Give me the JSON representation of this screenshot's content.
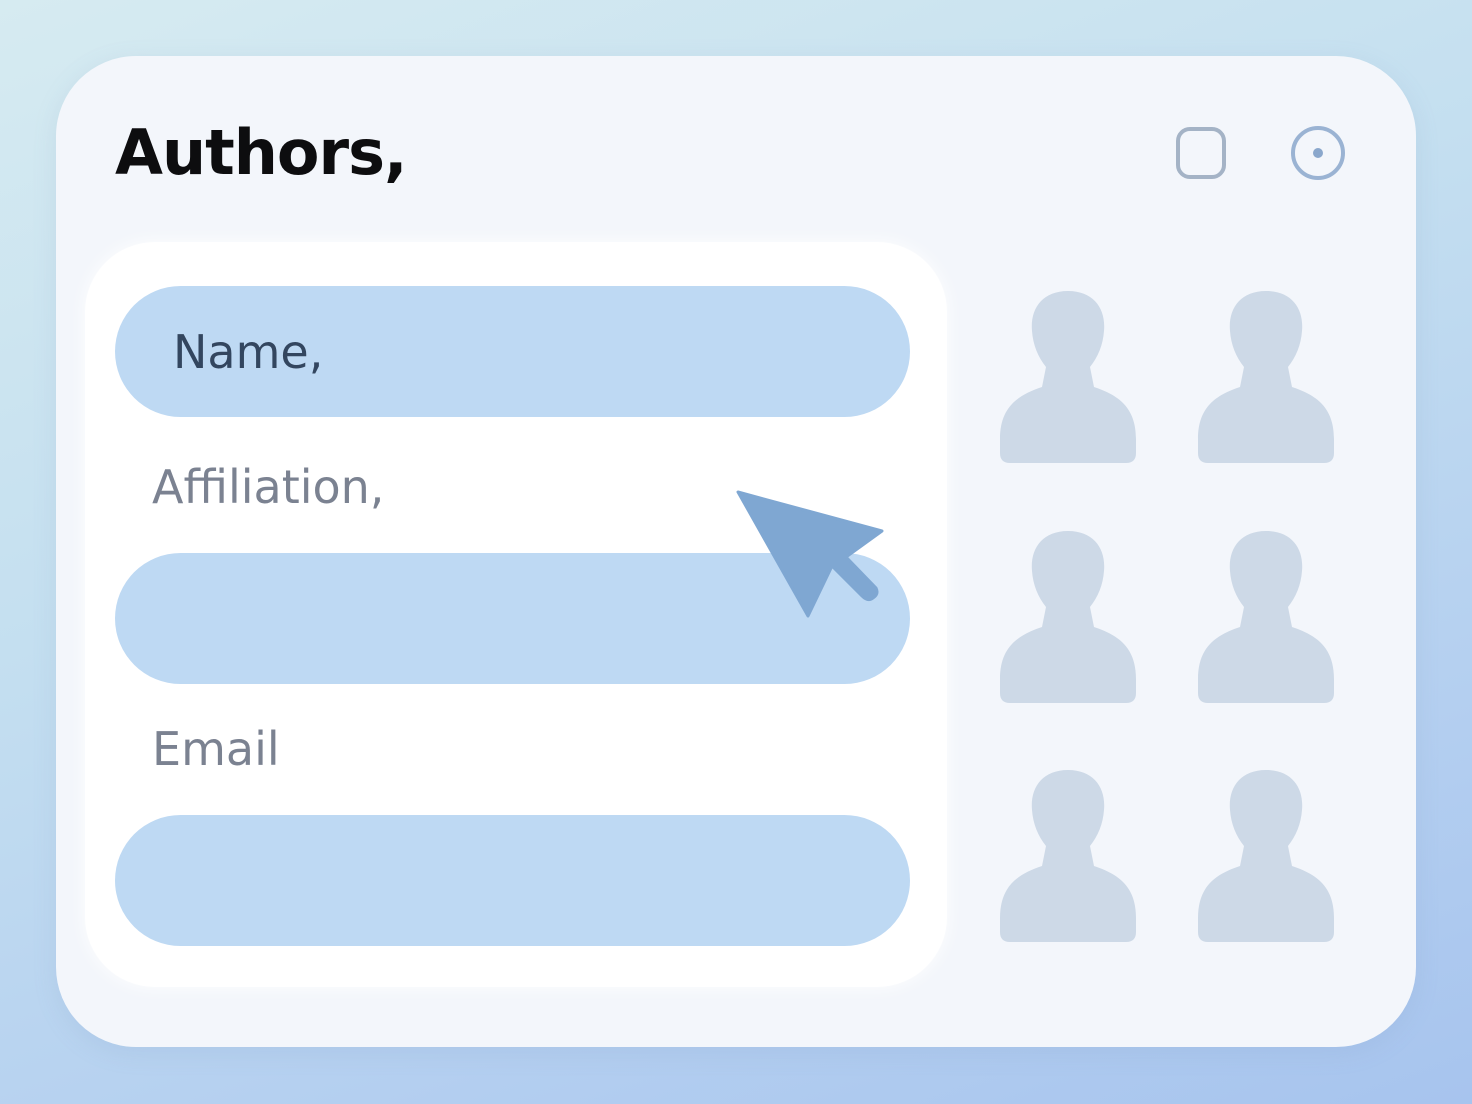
{
  "header": {
    "title": "Authors,"
  },
  "window_controls": [
    {
      "name": "square-icon"
    },
    {
      "name": "circle-dot-icon"
    }
  ],
  "form": {
    "name_field": {
      "value": "Name,"
    },
    "affiliation": {
      "label": "Affiliation,",
      "value": ""
    },
    "email": {
      "label": "Email",
      "value": ""
    }
  },
  "author_avatars": [
    {
      "icon": "person-icon"
    },
    {
      "icon": "person-icon"
    },
    {
      "icon": "person-icon"
    },
    {
      "icon": "person-icon"
    },
    {
      "icon": "person-icon"
    },
    {
      "icon": "person-icon"
    }
  ],
  "colors": {
    "field_fill": "#bed9f3",
    "accent_cursor": "#7fa7d2",
    "avatar_fill": "#cdd9e7"
  }
}
